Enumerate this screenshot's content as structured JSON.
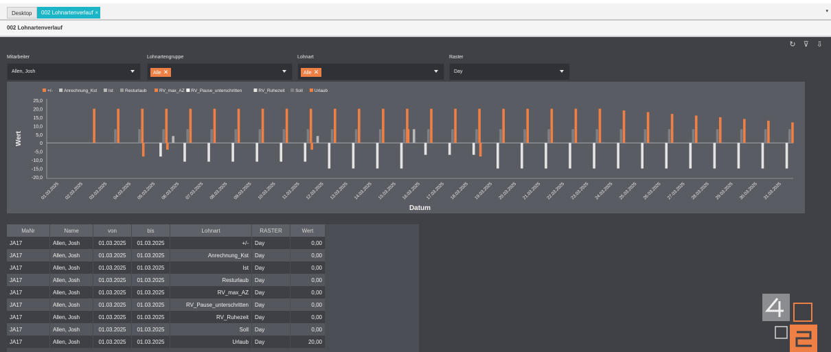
{
  "tabs": {
    "desktop": "Desktop",
    "active": "002 Lohnartenverlauf",
    "close": "×",
    "overflow": "▾"
  },
  "page_title": "002 Lohnartenverlauf",
  "header_icons": {
    "refresh": "↻",
    "filter_clear": "⊽",
    "export": "⇩"
  },
  "filters": {
    "mitarbeiter": {
      "label": "Mitarbeiter",
      "value": "Allen, Josh"
    },
    "lohnartengruppe": {
      "label": "Lohnartengruppe",
      "chip": "Alle"
    },
    "lohnart": {
      "label": "Lohnart",
      "chip": "Alle"
    },
    "raster": {
      "label": "Raster",
      "value": "Day"
    }
  },
  "colors": {
    "accent": "#ee7f45",
    "tab": "#1cb5c8",
    "gray_bar": "#8a8c91",
    "light_bar": "#e0e0e0"
  },
  "chart_data": {
    "type": "bar",
    "xlabel": "Datum",
    "ylabel": "Wert",
    "ylim": [
      -20,
      25
    ],
    "yticks": [
      "25,0",
      "20,0",
      "15,0",
      "10,0",
      "5,0",
      "0",
      "-5,0",
      "-10,0",
      "-15,0",
      "-20,0"
    ],
    "legend_position": "top-left",
    "categories": [
      "01.03.2025",
      "02.03.2025",
      "03.03.2025",
      "04.03.2025",
      "05.03.2025",
      "06.03.2025",
      "07.03.2025",
      "08.03.2025",
      "09.03.2025",
      "10.03.2025",
      "11.03.2025",
      "12.03.2025",
      "13.03.2025",
      "14.03.2025",
      "15.03.2025",
      "16.03.2025",
      "17.03.2025",
      "18.03.2025",
      "19.03.2025",
      "20.03.2025",
      "21.03.2025",
      "22.03.2025",
      "23.03.2025",
      "24.03.2025",
      "25.03.2025",
      "26.03.2025",
      "27.03.2025",
      "28.03.2025",
      "29.03.2025",
      "30.03.2025",
      "31.03.2025"
    ],
    "series": [
      {
        "name": "+/-",
        "color": "#ee7f45",
        "values": [
          0,
          0,
          0,
          0,
          -8,
          -4,
          0,
          0,
          0,
          0,
          0,
          -4,
          0,
          0,
          0,
          8,
          0,
          0,
          -8,
          0,
          0,
          0,
          0,
          0,
          0,
          0,
          0,
          0,
          0,
          0,
          0
        ]
      },
      {
        "name": "Anrechnung_Kst",
        "color": "#c8c8c8",
        "values": [
          0,
          0,
          0,
          0,
          0,
          0,
          0,
          0,
          0,
          0,
          0,
          0,
          0,
          0,
          0,
          0,
          0,
          0,
          0,
          0,
          0,
          0,
          0,
          0,
          0,
          0,
          0,
          0,
          0,
          0,
          0
        ]
      },
      {
        "name": "Ist",
        "color": "#b8b8b8",
        "values": [
          0,
          0,
          0,
          0,
          0,
          4,
          0,
          0,
          0,
          0,
          0,
          4,
          0,
          0,
          0,
          8,
          0,
          0,
          0,
          0,
          0,
          0,
          0,
          0,
          0,
          0,
          0,
          0,
          0,
          0,
          0
        ]
      },
      {
        "name": "Resturlaub",
        "color": "#9a9a9a",
        "values": [
          0,
          0,
          0,
          0,
          0,
          0,
          0,
          0,
          0,
          0,
          0,
          0,
          0,
          0,
          0,
          0,
          0,
          0,
          0,
          0,
          0,
          0,
          0,
          0,
          0,
          0,
          0,
          0,
          0,
          0,
          0
        ]
      },
      {
        "name": "RV_max_AZ",
        "color": "#ee7f45",
        "values": [
          0,
          0,
          0,
          0,
          0,
          0,
          0,
          0,
          0,
          0,
          0,
          0,
          0,
          0,
          0,
          0,
          0,
          0,
          0,
          0,
          0,
          0,
          0,
          0,
          0,
          0,
          0,
          0,
          0,
          0,
          0
        ]
      },
      {
        "name": "RV_Pause_unterschritten",
        "color": "#f2f2f2",
        "values": [
          0,
          0,
          0,
          0,
          0,
          0,
          0,
          0,
          0,
          0,
          0,
          0,
          0,
          0,
          0,
          0,
          0,
          0,
          0,
          0,
          0,
          0,
          0,
          0,
          0,
          0,
          0,
          0,
          0,
          0,
          0
        ]
      },
      {
        "name": "RV_Ruhezeit",
        "color": "#e4e4e4",
        "values": [
          0,
          0,
          0,
          0,
          -8,
          -11,
          -11,
          -11,
          -11,
          -11,
          -11,
          -15,
          -15,
          -15,
          -15,
          -7,
          -7,
          -7,
          -15,
          -15,
          -15,
          -15,
          -15,
          -15,
          -15,
          -15,
          -15,
          -15,
          -15,
          -15,
          -15
        ]
      },
      {
        "name": "Soll",
        "color": "#7d7f84",
        "values": [
          0,
          0,
          8,
          8,
          8,
          8,
          8,
          8,
          8,
          8,
          8,
          8,
          8,
          8,
          8,
          8,
          8,
          8,
          8,
          8,
          8,
          8,
          8,
          8,
          8,
          8,
          8,
          8,
          8,
          8,
          8
        ]
      },
      {
        "name": "Urlaub",
        "color": "#ee7f45",
        "values": [
          0,
          20,
          20,
          20,
          20,
          20,
          20,
          20,
          20,
          20,
          20,
          20,
          20,
          20,
          20,
          20,
          20,
          20,
          20,
          20,
          20,
          20,
          20,
          19,
          18,
          17,
          16,
          15,
          14,
          13,
          12
        ]
      }
    ]
  },
  "table": {
    "columns": [
      "MaNr",
      "Name",
      "von",
      "bis",
      "Lohnart",
      "RASTER",
      "Wert"
    ],
    "rows": [
      [
        "JA17",
        "Allen, Josh",
        "01.03.2025",
        "01.03.2025",
        "+/-",
        "Day",
        "0,00"
      ],
      [
        "JA17",
        "Allen, Josh",
        "01.03.2025",
        "01.03.2025",
        "Anrechnung_Kst",
        "Day",
        "0,00"
      ],
      [
        "JA17",
        "Allen, Josh",
        "01.03.2025",
        "01.03.2025",
        "Ist",
        "Day",
        "0,00"
      ],
      [
        "JA17",
        "Allen, Josh",
        "01.03.2025",
        "01.03.2025",
        "Resturlaub",
        "Day",
        "0,00"
      ],
      [
        "JA17",
        "Allen, Josh",
        "01.03.2025",
        "01.03.2025",
        "RV_max_AZ",
        "Day",
        "0,00"
      ],
      [
        "JA17",
        "Allen, Josh",
        "01.03.2025",
        "01.03.2025",
        "RV_Pause_unterschritten",
        "Day",
        "0,00"
      ],
      [
        "JA17",
        "Allen, Josh",
        "01.03.2025",
        "01.03.2025",
        "RV_Ruhezeit",
        "Day",
        "0,00"
      ],
      [
        "JA17",
        "Allen, Josh",
        "01.03.2025",
        "01.03.2025",
        "Soll",
        "Day",
        "0,00"
      ],
      [
        "JA17",
        "Allen, Josh",
        "01.03.2025",
        "01.03.2025",
        "Urlaub",
        "Day",
        "20,00"
      ]
    ]
  }
}
